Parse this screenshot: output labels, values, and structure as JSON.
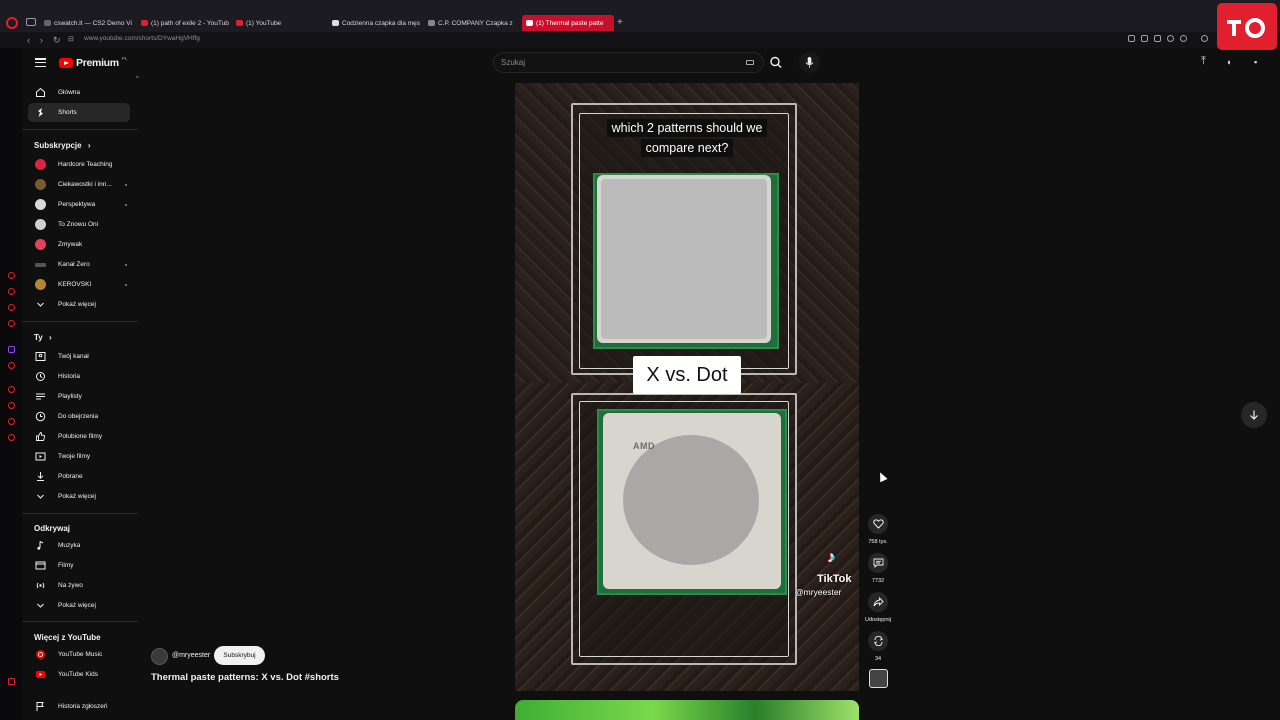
{
  "browser": {
    "tabs": [
      {
        "label": "cswatch.lt — CS2 Demo Vi",
        "active": false
      },
      {
        "label": "(1) path of exile 2 - YouTub",
        "active": false
      },
      {
        "label": "(1) YouTube",
        "active": false
      },
      {
        "label": "Codzienna czapka dla męs",
        "active": false
      },
      {
        "label": "C.P. COMPANY Czapka z ",
        "active": false
      },
      {
        "label": "(1) Thermal paste patte",
        "active": true
      }
    ],
    "url": "www.youtube.com/shorts/DYwaHgVHffg"
  },
  "header": {
    "logo_word": "Premium",
    "logo_country": "PL",
    "search_placeholder": "Szukaj"
  },
  "sidebar": {
    "main": [
      {
        "label": "Główna",
        "icon": "home-icon"
      },
      {
        "label": "Shorts",
        "icon": "shorts-icon",
        "active": true
      }
    ],
    "subs_heading": "Subskrypcje",
    "subscriptions": [
      {
        "label": "Hardcore Teaching",
        "color": "#e02240",
        "dot": false
      },
      {
        "label": "Ciekawostki i inn...",
        "color": "#7a5a2a",
        "dot": true
      },
      {
        "label": "Perspektywa",
        "color": "#d9d9d9",
        "dot": true
      },
      {
        "label": "To Znowu Oni",
        "color": "#cfcfcf",
        "dot": false
      },
      {
        "label": "Zmywak",
        "color": "#e8405a",
        "dot": false
      },
      {
        "label": "Kanał Zero",
        "color": "#555555",
        "dot": true
      },
      {
        "label": "KEROVSKI",
        "color": "#b8862e",
        "dot": true
      }
    ],
    "subs_more": "Pokaż więcej",
    "you_heading": "Ty",
    "you": [
      {
        "label": "Twój kanał",
        "icon": "channel-icon"
      },
      {
        "label": "Historia",
        "icon": "history-icon"
      },
      {
        "label": "Playlisty",
        "icon": "playlist-icon"
      },
      {
        "label": "Do obejrzenia",
        "icon": "clock-icon"
      },
      {
        "label": "Polubione filmy",
        "icon": "like-icon"
      },
      {
        "label": "Twoje filmy",
        "icon": "video-icon"
      },
      {
        "label": "Pobrane",
        "icon": "download-icon"
      }
    ],
    "you_more": "Pokaż więcej",
    "explore_heading": "Odkrywaj",
    "explore": [
      {
        "label": "Muzyka",
        "icon": "music-icon"
      },
      {
        "label": "Filmy",
        "icon": "film-icon"
      },
      {
        "label": "Na żywo",
        "icon": "live-icon"
      }
    ],
    "explore_more": "Pokaż więcej",
    "more_heading": "Więcej z YouTube",
    "more": [
      {
        "label": "YouTube Music",
        "icon": "youtube-music-icon"
      },
      {
        "label": "YouTube Kids",
        "icon": "youtube-kids-icon"
      },
      {
        "label": "Historia zgłoszeń",
        "icon": "flag-icon"
      }
    ]
  },
  "video": {
    "caption_line1": "which 2 patterns should we",
    "caption_line2": "compare next?",
    "versus_text": "X vs. Dot",
    "cpu_brand": "AMD",
    "watermark_brand": "TikTok",
    "watermark_user": "@mryeester"
  },
  "actions": {
    "likes": "758 tys.",
    "comments": "7732",
    "share": "Udostępnij",
    "remix": "34"
  },
  "meta": {
    "channel": "@mryeester",
    "subscribe": "Subskrybuj",
    "title": "Thermal paste patterns: X vs. Dot #shorts"
  }
}
